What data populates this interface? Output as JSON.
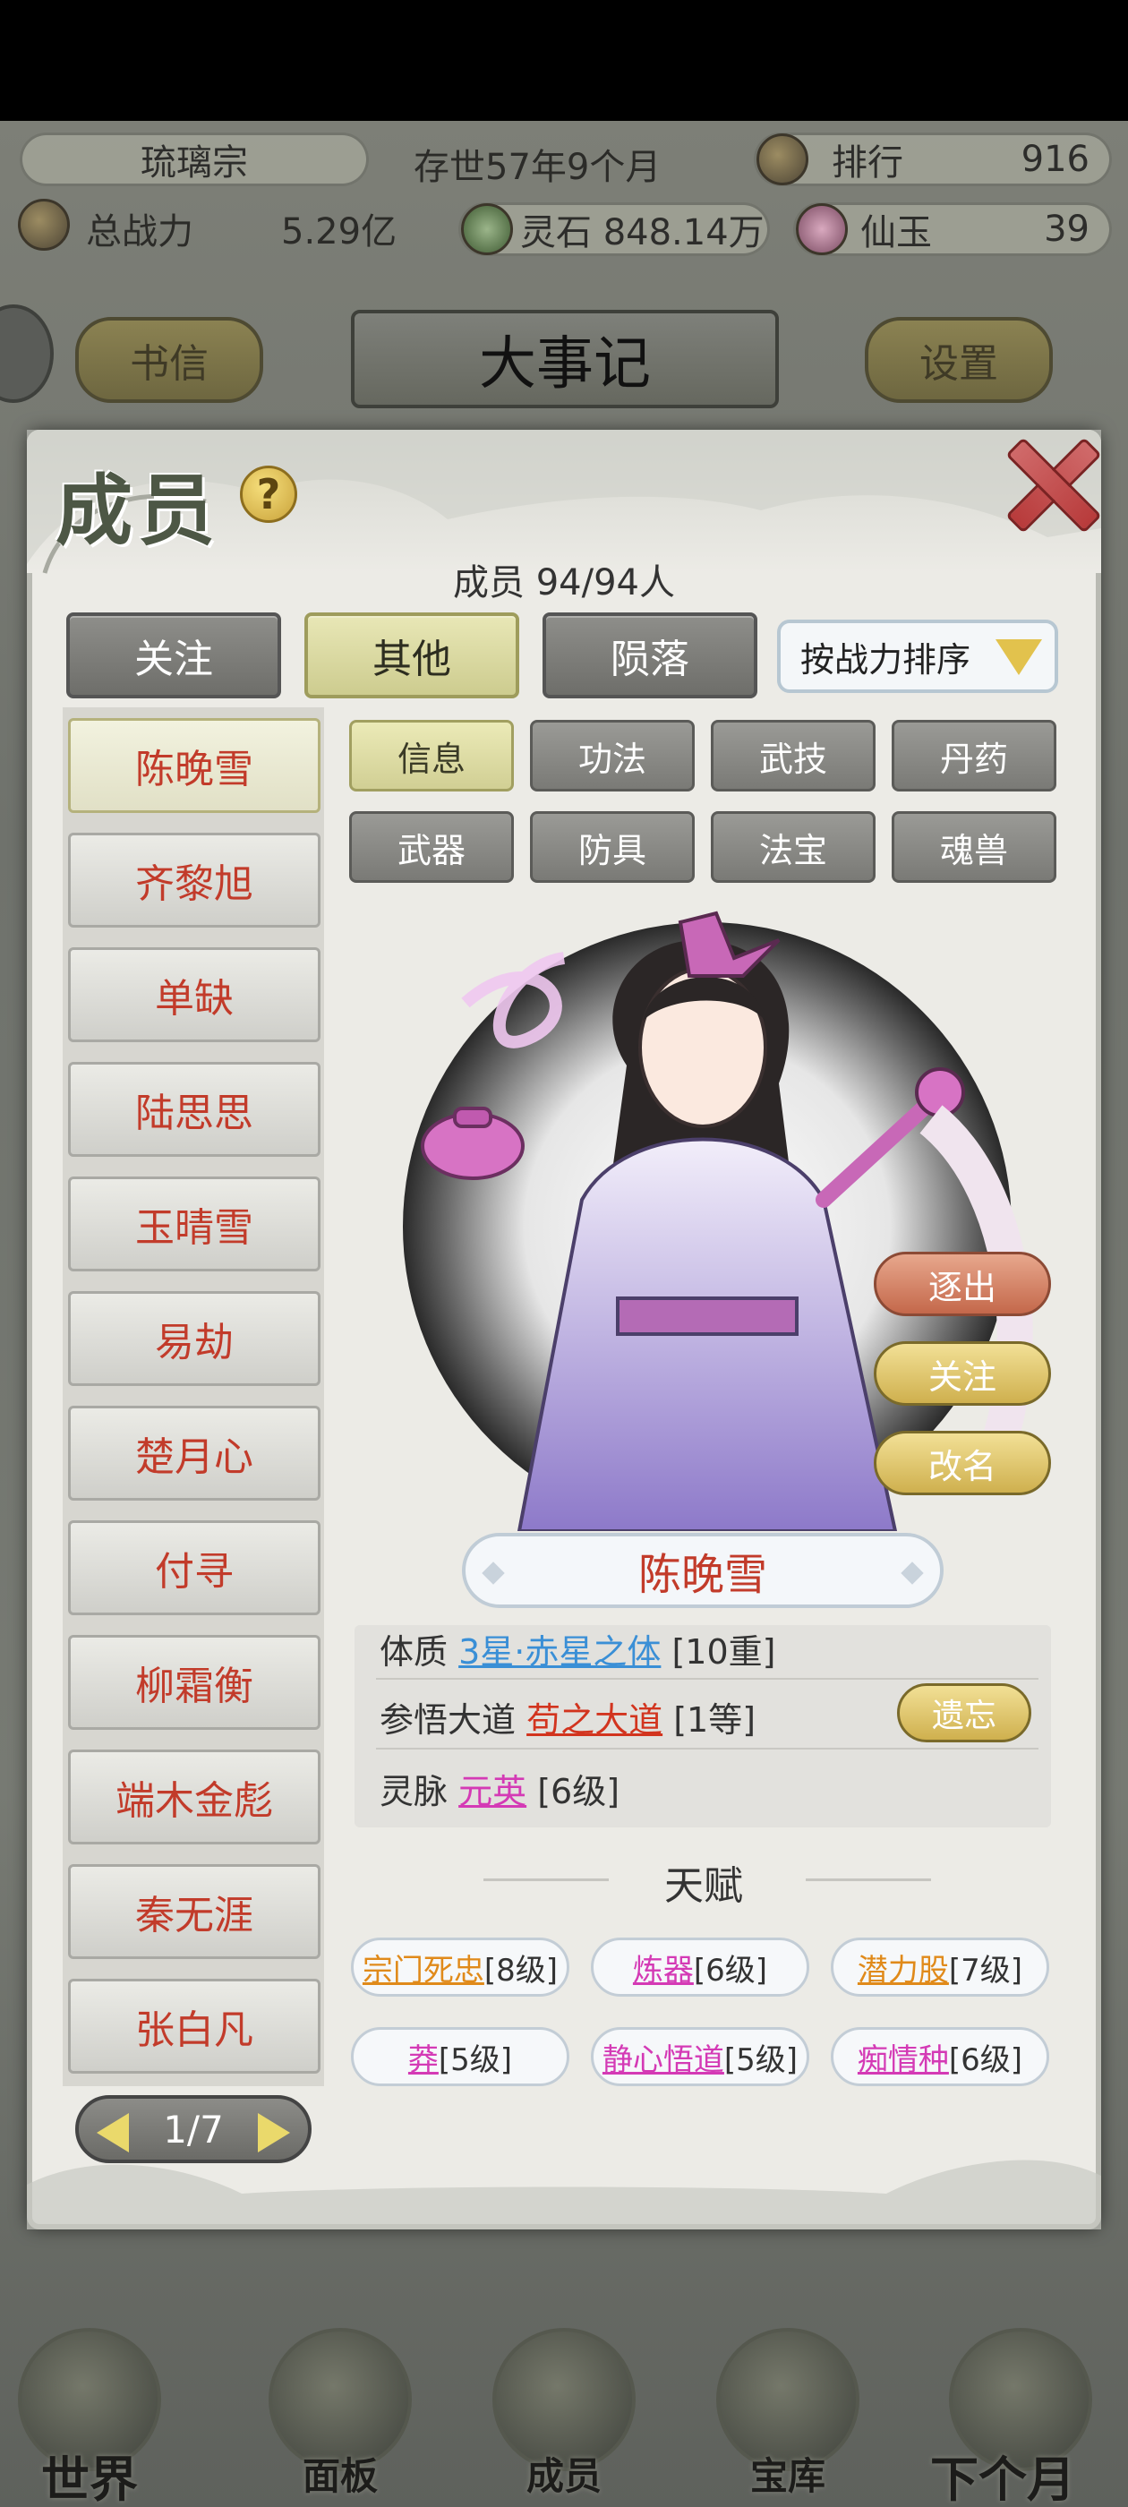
{
  "hud": {
    "sect_name": "琉璃宗",
    "age": "存世57年9个月",
    "rank_label": "排行",
    "rank_value": "916",
    "power_label": "总战力",
    "power_value": "5.29亿",
    "spirit_stone": "灵石 848.14万",
    "jade_label": "仙玉",
    "jade_value": "39"
  },
  "background_buttons": {
    "letters": "书信",
    "chronicle": "大事记",
    "settings": "设置"
  },
  "bottom_nav": [
    "世界",
    "面板",
    "成员",
    "宝库",
    "下个月"
  ],
  "panel": {
    "title": "成员",
    "help": "?",
    "member_count": "成员  94/94人",
    "tabs": [
      {
        "label": "关注",
        "active": false
      },
      {
        "label": "其他",
        "active": true
      },
      {
        "label": "陨落",
        "active": false
      }
    ],
    "sort_label": "按战力排序"
  },
  "members": [
    "陈晚雪",
    "齐黎旭",
    "单缺",
    "陆思思",
    "玉晴雪",
    "易劫",
    "楚月心",
    "付寻",
    "柳霜衡",
    "端木金彪",
    "秦无涯",
    "张白凡"
  ],
  "pager": "1/7",
  "detail_tabs": [
    "信息",
    "功法",
    "武技",
    "丹药",
    "武器",
    "防具",
    "法宝",
    "魂兽"
  ],
  "actions": {
    "expel": "逐出",
    "follow": "关注",
    "rename": "改名"
  },
  "selected_name": "陈晚雪",
  "info": {
    "constitution_label": "体质",
    "constitution_value": "3星·赤星之体",
    "constitution_level": "[10重]",
    "dao_label": "参悟大道",
    "dao_value": "苟之大道",
    "dao_level": "[1等]",
    "forget": "遗忘",
    "vein_label": "灵脉",
    "vein_value": "元英",
    "vein_level": "[6级]"
  },
  "talent_title": "天赋",
  "talents": [
    {
      "name": "宗门死忠",
      "level": "[8级]",
      "color": "#e08a1a"
    },
    {
      "name": "炼器",
      "level": "[6级]",
      "color": "#d43ab5"
    },
    {
      "name": "潜力股",
      "level": "[7级]",
      "color": "#e08a1a"
    },
    {
      "name": "莽",
      "level": "[5级]",
      "color": "#d43ab5"
    },
    {
      "name": "静心悟道",
      "level": "[5级]",
      "color": "#d43ab5"
    },
    {
      "name": "痴情种",
      "level": "[6级]",
      "color": "#d43ab5"
    }
  ]
}
